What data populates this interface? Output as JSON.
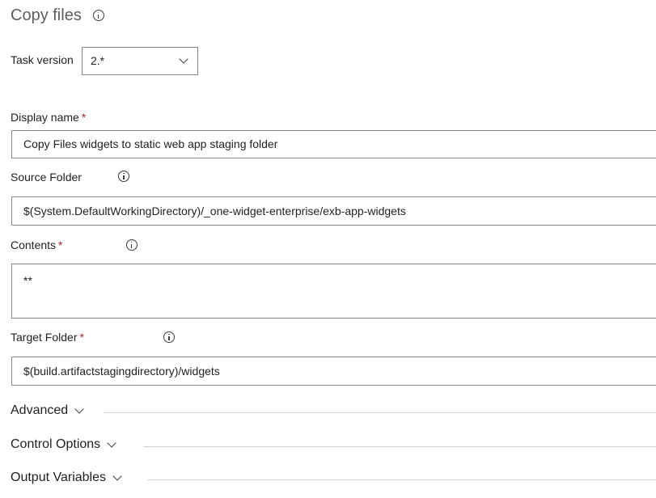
{
  "header": {
    "title": "Copy files",
    "icon": "info-icon"
  },
  "task_version": {
    "label": "Task version",
    "value": "2.*",
    "icon": "chevron-down-icon"
  },
  "display_name": {
    "label": "Display name",
    "required_mark": "*",
    "value": "Copy Files widgets to static web app staging folder"
  },
  "source_folder": {
    "label": "Source Folder",
    "value": "$(System.DefaultWorkingDirectory)/_one-widget-enterprise/exb-app-widgets",
    "icon": "info-icon"
  },
  "contents": {
    "label": "Contents",
    "required_mark": "*",
    "value": "**",
    "icon": "info-icon"
  },
  "target_folder": {
    "label": "Target Folder",
    "required_mark": "*",
    "value": "$(build.artifactstagingdirectory)/widgets",
    "icon": "info-icon"
  },
  "sections": [
    {
      "label": "Advanced",
      "icon": "chevron-down-icon"
    },
    {
      "label": "Control Options",
      "icon": "chevron-down-icon"
    },
    {
      "label": "Output Variables",
      "icon": "chevron-down-icon"
    }
  ],
  "colors": {
    "required": "#a4262c",
    "border": "#8a8886",
    "title": "#605e5c"
  }
}
